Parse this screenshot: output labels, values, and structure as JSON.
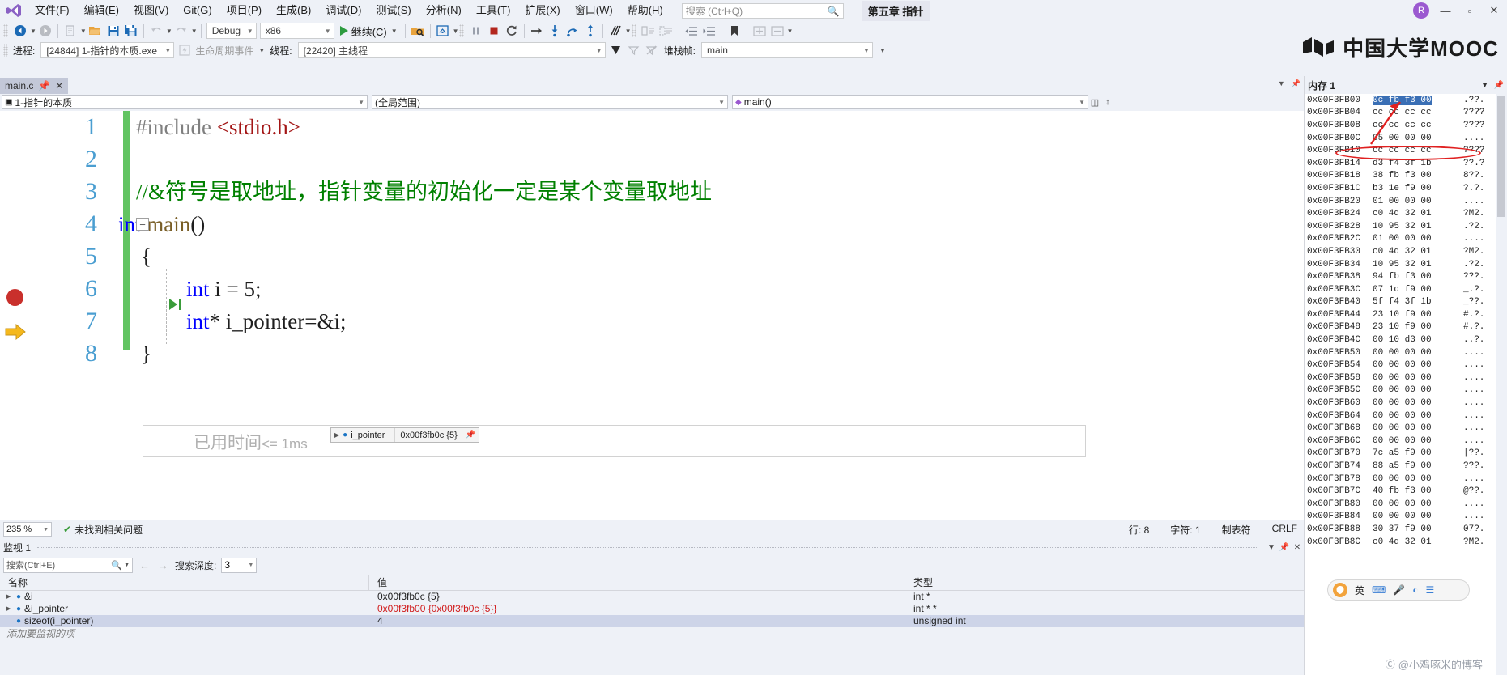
{
  "titlebar": {
    "logo_icon": "visual-studio-logo",
    "menus": [
      {
        "label": "文件(F)"
      },
      {
        "label": "编辑(E)"
      },
      {
        "label": "视图(V)"
      },
      {
        "label": "Git(G)"
      },
      {
        "label": "项目(P)"
      },
      {
        "label": "生成(B)"
      },
      {
        "label": "调试(D)"
      },
      {
        "label": "测试(S)"
      },
      {
        "label": "分析(N)"
      },
      {
        "label": "工具(T)"
      },
      {
        "label": "扩展(X)"
      },
      {
        "label": "窗口(W)"
      },
      {
        "label": "帮助(H)"
      }
    ],
    "search_placeholder": "搜索 (Ctrl+Q)",
    "search_icon": "magnifier-icon",
    "document_title": "第五章 指针",
    "avatar_label": "R",
    "minimize_label": "—",
    "maximize_label": "▫",
    "close_label": "✕"
  },
  "toolbar": {
    "nav_back_icon": "navigate-back-icon",
    "nav_forward_icon": "navigate-forward-icon",
    "new_item_icon": "new-item-icon",
    "open_icon": "open-folder-icon",
    "save_icon": "save-icon",
    "save_all_icon": "save-all-icon",
    "undo_icon": "undo-icon",
    "redo_icon": "redo-icon",
    "config_value": "Debug",
    "platform_value": "x86",
    "continue_label": "继续(C)",
    "continue_icon": "play-icon",
    "attach_icon": "attach-process-icon",
    "hot_reload_icon": "hot-reload-icon",
    "pause_icon": "pause-icon",
    "stop_icon": "stop-icon",
    "restart_icon": "restart-icon",
    "show_next_icon": "show-next-statement-icon",
    "step_into_icon": "step-into-icon",
    "step_over_icon": "step-over-icon",
    "step_out_icon": "step-out-icon",
    "diagnostics_icon": "diagnostics-icon",
    "comment_icon": "comment-icon",
    "uncomment_icon": "uncomment-icon",
    "outdent_icon": "outdent-icon",
    "indent_icon": "indent-icon",
    "bookmark_icon": "bookmark-icon",
    "expand_icon": "expand-icon",
    "collapse_icon": "collapse-icon"
  },
  "process_bar": {
    "process_label": "进程:",
    "process_value": "[24844] 1-指针的本质.exe",
    "lifecycle_label": "生命周期事件",
    "lifecycle_icon": "lifecycle-events-icon",
    "thread_label": "线程:",
    "thread_value": "[22420] 主线程",
    "flag_icon": "flag-icon",
    "filter_icon": "filter-icon",
    "nostack_icon": "no-stack-icon",
    "stackframe_label": "堆栈帧:",
    "stackframe_value": "main"
  },
  "brand": {
    "name": "中国大学MOOC",
    "mark_icon": "mooc-mark-icon"
  },
  "editor": {
    "tab": {
      "name": "main.c",
      "pin_icon": "pin-icon",
      "close_icon": "close-icon"
    },
    "nav": {
      "project_value": "1-指针的本质",
      "project_icon": "project-icon",
      "scope_value": "(全局范围)",
      "member_value": "main()",
      "member_icon": "method-icon",
      "split_icon": "split-view-icon",
      "updown_icon": "updown-icon"
    },
    "breakpoint_icon": "breakpoint-icon",
    "current_line_icon": "current-statement-arrow-icon",
    "fold_icon": "collapse-region-icon",
    "exec_marker_icon": "execution-pointer-icon",
    "lines": [
      {
        "no": "1",
        "tokens": [
          {
            "t": "#include ",
            "c": "k-pre"
          },
          {
            "t": "<stdio.h>",
            "c": "k-str"
          }
        ]
      },
      {
        "no": "2",
        "tokens": []
      },
      {
        "no": "3",
        "tokens": [
          {
            "t": "//&符号是取地址，指针变量的初始化一定是某个变量取地址",
            "c": "k-cmt"
          }
        ]
      },
      {
        "no": "4",
        "tokens": [
          {
            "t": "int ",
            "c": "k-kw"
          },
          {
            "t": "main",
            "c": "k-fn"
          },
          {
            "t": "()",
            "c": "k-pl"
          }
        ]
      },
      {
        "no": "5",
        "tokens": [
          {
            "t": "{",
            "c": "k-pl"
          }
        ]
      },
      {
        "no": "6",
        "tokens": [
          {
            "t": "int",
            "c": "k-kw"
          },
          {
            "t": " i = ",
            "c": "k-pl"
          },
          {
            "t": "5",
            "c": "k-pl"
          },
          {
            "t": ";",
            "c": "k-pl"
          }
        ]
      },
      {
        "no": "7",
        "tokens": [
          {
            "t": "int",
            "c": "k-kw"
          },
          {
            "t": "* i_pointer=&i;",
            "c": "k-pl"
          }
        ]
      },
      {
        "no": "8",
        "tokens": [
          {
            "t": "}",
            "c": "k-pl"
          }
        ]
      }
    ],
    "elapsed_main": "已用时间",
    "elapsed_value": "<= 1ms",
    "datatip": {
      "expand_icon": "expander-triangle-icon",
      "var_icon": "variable-icon",
      "name": "i_pointer",
      "value": "0x00f3fb0c {5}",
      "pin_icon": "pin-datatip-icon"
    }
  },
  "statusbar": {
    "zoom_value": "235 %",
    "problems_icon": "check-circle-icon",
    "problems_text": "未找到相关问题",
    "line_text": "行: 8",
    "char_text": "字符: 1",
    "tab_text": "制表符",
    "eol_text": "CRLF"
  },
  "watch": {
    "title": "监视 1",
    "pin_icon": "pin-icon",
    "close_icon": "close-icon",
    "dropdown_icon": "chevron-down-icon",
    "search_placeholder": "搜索(Ctrl+E)",
    "search_icon": "magnifier-icon",
    "search_caret_icon": "chevron-down-icon",
    "prev_icon": "arrow-left-icon",
    "next_icon": "arrow-right-icon",
    "depth_label": "搜索深度:",
    "depth_value": "3",
    "columns": [
      "名称",
      "值",
      "类型"
    ],
    "rows": [
      {
        "expandable": true,
        "icon": "variable-icon",
        "name": "&i",
        "value": "0x00f3fb0c {5}",
        "value_red": false,
        "type": "int *",
        "selected": false
      },
      {
        "expandable": true,
        "icon": "variable-icon",
        "name": "&i_pointer",
        "value": "0x00f3fb00 {0x00f3fb0c {5}}",
        "value_red": true,
        "type": "int * *",
        "selected": false
      },
      {
        "expandable": false,
        "icon": "variable-icon",
        "name": "sizeof(i_pointer)",
        "value": "4",
        "value_red": false,
        "type": "unsigned int",
        "selected": true
      }
    ],
    "add_item_text": "添加要监视的项"
  },
  "memory": {
    "title": "内存 1",
    "dropdown_icon": "chevron-down-icon",
    "pin_icon": "pin-icon",
    "rows": [
      {
        "addr": "0x00F3FB00",
        "hex": "0c fb f3 00",
        "ascii": ".??.",
        "highlight": true
      },
      {
        "addr": "0x00F3FB04",
        "hex": "cc cc cc cc",
        "ascii": "????",
        "highlight": false
      },
      {
        "addr": "0x00F3FB08",
        "hex": "cc cc cc cc",
        "ascii": "????",
        "highlight": false
      },
      {
        "addr": "0x00F3FB0C",
        "hex": "05 00 00 00",
        "ascii": "....",
        "highlight": false
      },
      {
        "addr": "0x00F3FB10",
        "hex": "cc cc cc cc",
        "ascii": "????",
        "highlight": false
      },
      {
        "addr": "0x00F3FB14",
        "hex": "d3 f4 3f 1b",
        "ascii": "??.?",
        "highlight": false
      },
      {
        "addr": "0x00F3FB18",
        "hex": "38 fb f3 00",
        "ascii": "8??.",
        "highlight": false
      },
      {
        "addr": "0x00F3FB1C",
        "hex": "b3 1e f9 00",
        "ascii": "?.?.",
        "highlight": false
      },
      {
        "addr": "0x00F3FB20",
        "hex": "01 00 00 00",
        "ascii": "....",
        "highlight": false
      },
      {
        "addr": "0x00F3FB24",
        "hex": "c0 4d 32 01",
        "ascii": "?M2.",
        "highlight": false
      },
      {
        "addr": "0x00F3FB28",
        "hex": "10 95 32 01",
        "ascii": ".?2.",
        "highlight": false
      },
      {
        "addr": "0x00F3FB2C",
        "hex": "01 00 00 00",
        "ascii": "....",
        "highlight": false
      },
      {
        "addr": "0x00F3FB30",
        "hex": "c0 4d 32 01",
        "ascii": "?M2.",
        "highlight": false
      },
      {
        "addr": "0x00F3FB34",
        "hex": "10 95 32 01",
        "ascii": ".?2.",
        "highlight": false
      },
      {
        "addr": "0x00F3FB38",
        "hex": "94 fb f3 00",
        "ascii": "???.",
        "highlight": false
      },
      {
        "addr": "0x00F3FB3C",
        "hex": "07 1d f9 00",
        "ascii": "_.?.",
        "highlight": false
      },
      {
        "addr": "0x00F3FB40",
        "hex": "5f f4 3f 1b",
        "ascii": "_??.",
        "highlight": false
      },
      {
        "addr": "0x00F3FB44",
        "hex": "23 10 f9 00",
        "ascii": "#.?.",
        "highlight": false
      },
      {
        "addr": "0x00F3FB48",
        "hex": "23 10 f9 00",
        "ascii": "#.?.",
        "highlight": false
      },
      {
        "addr": "0x00F3FB4C",
        "hex": "00 10 d3 00",
        "ascii": "..?.",
        "highlight": false
      },
      {
        "addr": "0x00F3FB50",
        "hex": "00 00 00 00",
        "ascii": "....",
        "highlight": false
      },
      {
        "addr": "0x00F3FB54",
        "hex": "00 00 00 00",
        "ascii": "....",
        "highlight": false
      },
      {
        "addr": "0x00F3FB58",
        "hex": "00 00 00 00",
        "ascii": "....",
        "highlight": false
      },
      {
        "addr": "0x00F3FB5C",
        "hex": "00 00 00 00",
        "ascii": "....",
        "highlight": false
      },
      {
        "addr": "0x00F3FB60",
        "hex": "00 00 00 00",
        "ascii": "....",
        "highlight": false
      },
      {
        "addr": "0x00F3FB64",
        "hex": "00 00 00 00",
        "ascii": "....",
        "highlight": false
      },
      {
        "addr": "0x00F3FB68",
        "hex": "00 00 00 00",
        "ascii": "....",
        "highlight": false
      },
      {
        "addr": "0x00F3FB6C",
        "hex": "00 00 00 00",
        "ascii": "....",
        "highlight": false
      },
      {
        "addr": "0x00F3FB70",
        "hex": "7c a5 f9 00",
        "ascii": "|??.",
        "highlight": false
      },
      {
        "addr": "0x00F3FB74",
        "hex": "88 a5 f9 00",
        "ascii": "???.",
        "highlight": false
      },
      {
        "addr": "0x00F3FB78",
        "hex": "00 00 00 00",
        "ascii": "....",
        "highlight": false
      },
      {
        "addr": "0x00F3FB7C",
        "hex": "40 fb f3 00",
        "ascii": "@??.",
        "highlight": false
      },
      {
        "addr": "0x00F3FB80",
        "hex": "00 00 00 00",
        "ascii": "....",
        "highlight": false
      },
      {
        "addr": "0x00F3FB84",
        "hex": "00 00 00 00",
        "ascii": "....",
        "highlight": false
      },
      {
        "addr": "0x00F3FB88",
        "hex": "30 37 f9 00",
        "ascii": "07?.",
        "highlight": false
      },
      {
        "addr": "0x00F3FB8C",
        "hex": "c0 4d 32 01",
        "ascii": "?M2.",
        "highlight": false
      }
    ]
  },
  "ime": {
    "lang_label": "英",
    "logo_icon": "sogou-logo-icon",
    "keyboard_icon": "keyboard-icon",
    "mic_icon": "microphone-icon",
    "palette_icon": "palette-icon",
    "more_icon": "more-icon"
  },
  "watermark": {
    "text": "@小鸡啄米的博客"
  }
}
